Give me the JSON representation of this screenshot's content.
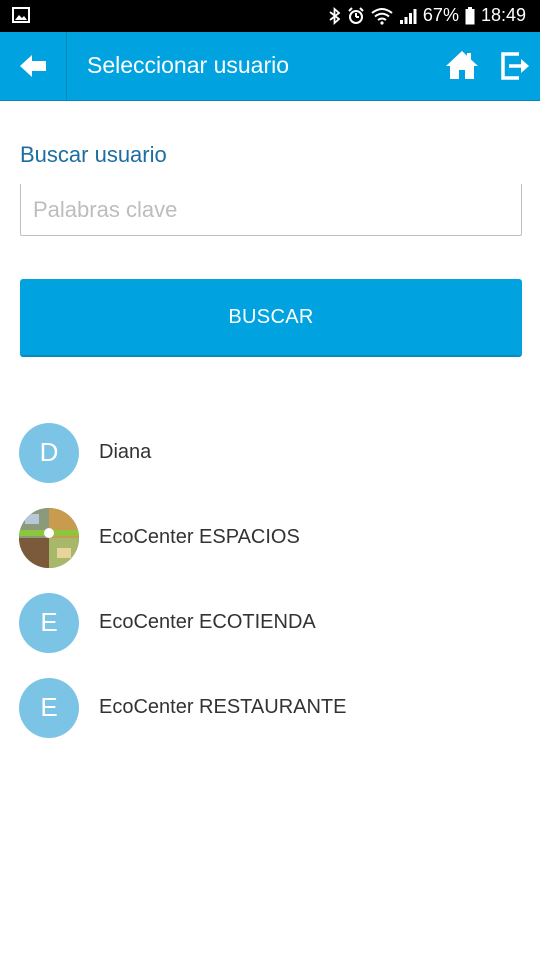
{
  "status_bar": {
    "battery_percent": "67%",
    "time": "18:49",
    "icons": [
      "image-icon",
      "bluetooth-icon",
      "alarm-icon",
      "wifi-icon",
      "signal-icon",
      "battery-icon"
    ]
  },
  "app_bar": {
    "title": "Seleccionar usuario",
    "back_icon": "arrow-left-icon",
    "home_icon": "home-icon",
    "exit_icon": "exit-icon",
    "color": "#00a3e0"
  },
  "search": {
    "label": "Buscar usuario",
    "placeholder": "Palabras clave",
    "value": "",
    "button_label": "BUSCAR"
  },
  "users": [
    {
      "initial": "D",
      "name": "Diana",
      "avatar": "letter"
    },
    {
      "initial": "",
      "name": "EcoCenter ESPACIOS",
      "avatar": "photo"
    },
    {
      "initial": "E",
      "name": "EcoCenter ECOTIENDA",
      "avatar": "letter"
    },
    {
      "initial": "E",
      "name": "EcoCenter RESTAURANTE",
      "avatar": "letter"
    }
  ]
}
